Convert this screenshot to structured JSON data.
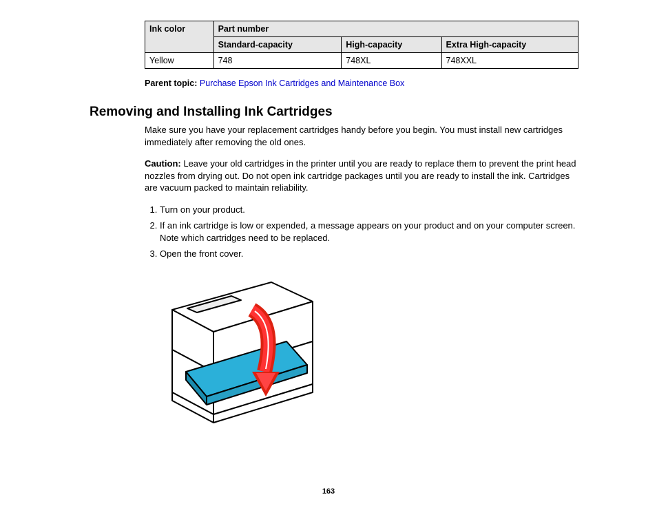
{
  "table": {
    "header": {
      "ink_color": "Ink color",
      "part_number": "Part number",
      "standard": "Standard-capacity",
      "high": "High-capacity",
      "extra_high": "Extra High-capacity"
    },
    "row": {
      "color": "Yellow",
      "standard": "748",
      "high": "748XL",
      "extra_high": "748XXL"
    }
  },
  "parent_topic": {
    "label": "Parent topic:",
    "link_text": "Purchase Epson Ink Cartridges and Maintenance Box"
  },
  "heading": "Removing and Installing Ink Cartridges",
  "intro": "Make sure you have your replacement cartridges handy before you begin. You must install new cartridges immediately after removing the old ones.",
  "caution": {
    "label": "Caution:",
    "text": "Leave your old cartridges in the printer until you are ready to replace them to prevent the print head nozzles from drying out. Do not open ink cartridge packages until you are ready to install the ink. Cartridges are vacuum packed to maintain reliability."
  },
  "steps": {
    "s1": "Turn on your product.",
    "s2": "If an ink cartridge is low or expended, a message appears on your product and on your computer screen. Note which cartridges need to be replaced.",
    "s3": "Open the front cover."
  },
  "page_number": "163"
}
